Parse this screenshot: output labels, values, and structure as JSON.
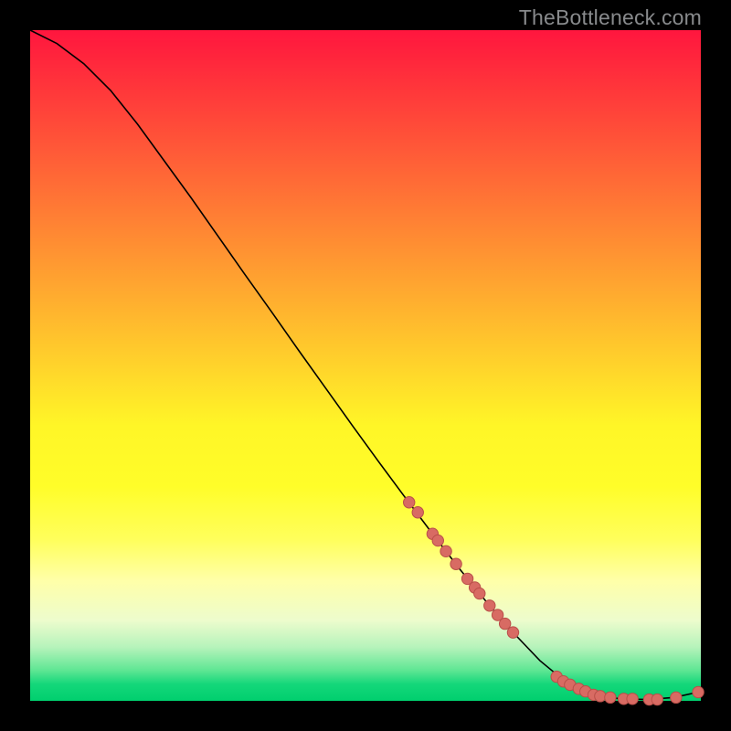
{
  "watermark": "TheBottleneck.com",
  "chart_data": {
    "type": "line",
    "title": "",
    "xlabel": "",
    "ylabel": "",
    "xlim": [
      0,
      100
    ],
    "ylim": [
      0,
      100
    ],
    "series": [
      {
        "name": "curve",
        "x": [
          0,
          4,
          8,
          12,
          16,
          20,
          24,
          28,
          32,
          36,
          40,
          44,
          48,
          52,
          56,
          60,
          64,
          68,
          72,
          76,
          80,
          84,
          88,
          92,
          96,
          99.6
        ],
        "y": [
          100,
          98,
          95,
          91,
          86,
          80.5,
          75,
          69.3,
          63.6,
          58,
          52.3,
          46.7,
          41.1,
          35.6,
          30.2,
          24.9,
          19.7,
          14.8,
          10.2,
          6.0,
          2.7,
          0.9,
          0.3,
          0.2,
          0.5,
          1.3
        ]
      }
    ],
    "points": {
      "name": "highlighted-points",
      "x": [
        56.5,
        57.8,
        60.0,
        60.8,
        62.0,
        63.5,
        65.2,
        66.3,
        67.0,
        68.5,
        69.7,
        70.8,
        72.0,
        78.5,
        79.5,
        80.5,
        81.8,
        82.8,
        84.0,
        85.0,
        86.5,
        88.5,
        89.8,
        92.3,
        93.5,
        96.3,
        99.6
      ],
      "y": [
        29.6,
        28.1,
        24.9,
        23.9,
        22.3,
        20.4,
        18.2,
        16.9,
        16.0,
        14.2,
        12.8,
        11.5,
        10.2,
        3.6,
        2.9,
        2.4,
        1.8,
        1.4,
        0.9,
        0.7,
        0.5,
        0.3,
        0.3,
        0.2,
        0.2,
        0.5,
        1.3
      ]
    },
    "colors": {
      "line": "#000000",
      "point_fill": "#d86b63",
      "point_stroke": "#b94f49"
    }
  }
}
